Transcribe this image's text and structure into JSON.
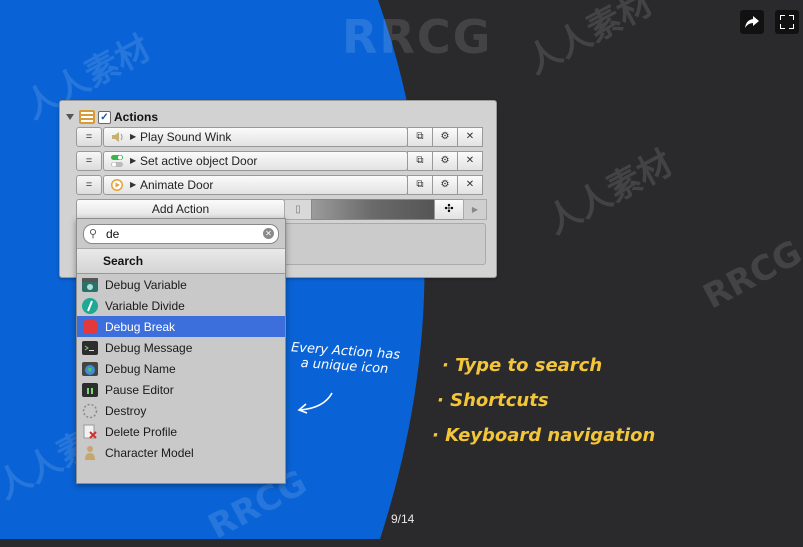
{
  "watermark": {
    "brand": "RRCG",
    "chinese": "人人素材"
  },
  "panel": {
    "title": "Actions",
    "rows": [
      {
        "label": "Play Sound Wink",
        "icon": "sound-icon"
      },
      {
        "label": "Set active object Door",
        "icon": "toggle-icon"
      },
      {
        "label": "Animate Door",
        "icon": "play-icon"
      }
    ],
    "add_action_label": "Add Action"
  },
  "search": {
    "value": "de",
    "title": "Search"
  },
  "results": [
    {
      "label": "Debug Variable",
      "icon": "variable-icon",
      "selected": false
    },
    {
      "label": "Variable Divide",
      "icon": "divide-icon",
      "selected": false
    },
    {
      "label": "Debug Break",
      "icon": "break-icon",
      "selected": true
    },
    {
      "label": "Debug Message",
      "icon": "console-icon",
      "selected": false
    },
    {
      "label": "Debug Name",
      "icon": "globe-icon",
      "selected": false
    },
    {
      "label": "Pause Editor",
      "icon": "pause-icon",
      "selected": false
    },
    {
      "label": "Destroy",
      "icon": "destroy-icon",
      "selected": false
    },
    {
      "label": "Delete Profile",
      "icon": "delete-profile-icon",
      "selected": false
    },
    {
      "label": "Character Model",
      "icon": "character-icon",
      "selected": false
    }
  ],
  "callout": {
    "line1": "Every Action has",
    "line2": "a unique icon"
  },
  "features": [
    "· Type to search",
    "· Shortcuts",
    "· Keyboard navigation"
  ],
  "pager": "9/14",
  "colors": {
    "blue": "#0a63d6",
    "dark": "#2a2a2c",
    "highlight": "#3d6fdc",
    "accent": "#f3c53a"
  }
}
